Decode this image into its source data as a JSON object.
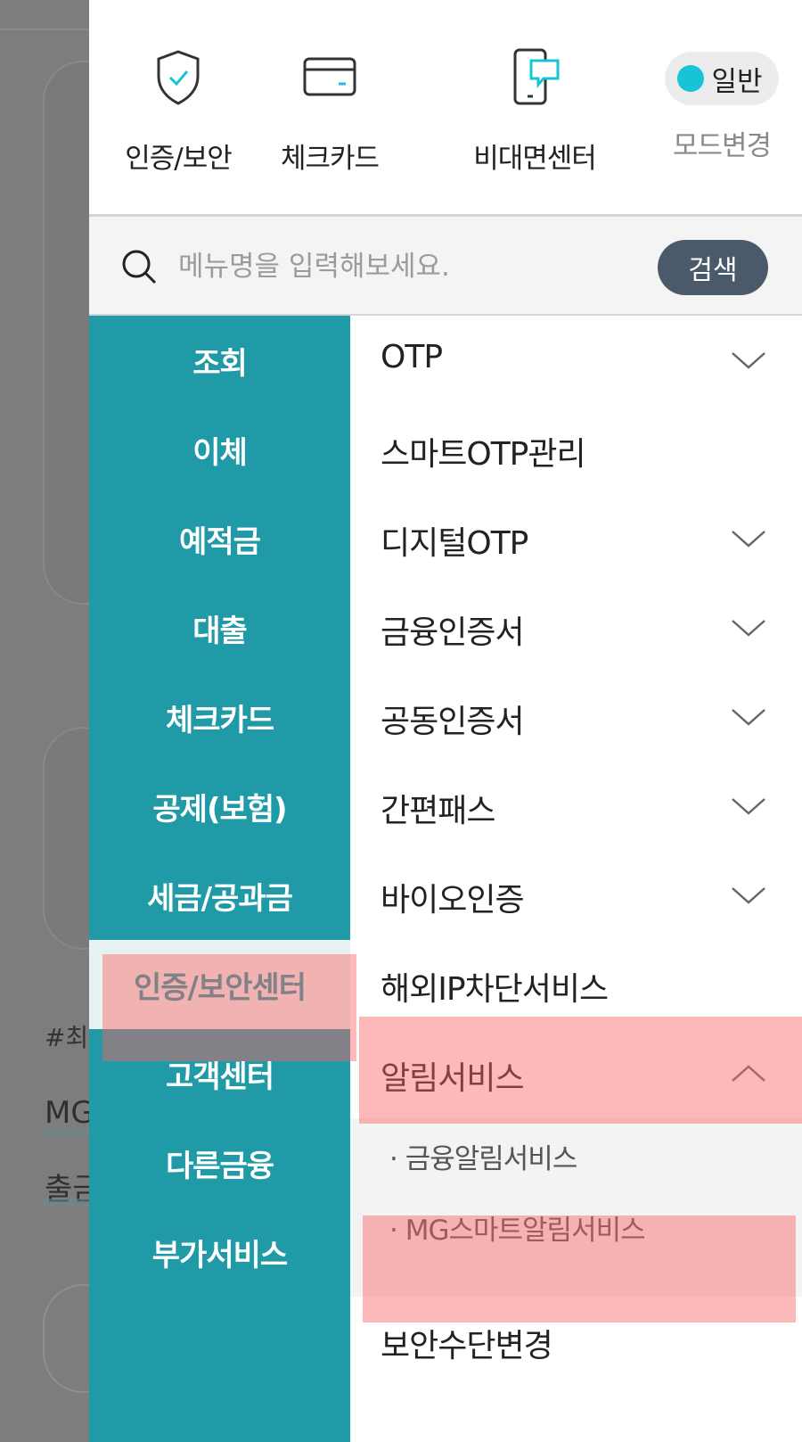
{
  "background": {
    "texts": [
      "#최",
      "MG",
      "출금"
    ]
  },
  "quick_menu": [
    {
      "label": "인증/보안",
      "icon": "shield-check-icon"
    },
    {
      "label": "체크카드",
      "icon": "card-icon"
    },
    {
      "label": "비대면센터",
      "icon": "phone-chat-icon"
    }
  ],
  "mode": {
    "current": "일반",
    "label": "모드변경",
    "dot_color": "#19c3d6"
  },
  "search": {
    "placeholder": "메뉴명을 입력해보세요.",
    "button_label": "검색"
  },
  "categories": [
    {
      "label": "조회",
      "active": false
    },
    {
      "label": "이체",
      "active": false
    },
    {
      "label": "예적금",
      "active": false
    },
    {
      "label": "대출",
      "active": false
    },
    {
      "label": "체크카드",
      "active": false
    },
    {
      "label": "공제(보험)",
      "active": false
    },
    {
      "label": "세금/공과금",
      "active": false
    },
    {
      "label": "인증/보안센터",
      "active": true
    },
    {
      "label": "고객센터",
      "active": false
    },
    {
      "label": "다른금융",
      "active": false
    },
    {
      "label": "부가서비스",
      "active": false
    }
  ],
  "submenu": [
    {
      "label": "OTP",
      "chevron": "down"
    },
    {
      "label": "스마트OTP관리",
      "chevron": "none"
    },
    {
      "label": "디지털OTP",
      "chevron": "down"
    },
    {
      "label": "금융인증서",
      "chevron": "down"
    },
    {
      "label": "공동인증서",
      "chevron": "down"
    },
    {
      "label": "간편패스",
      "chevron": "down"
    },
    {
      "label": "바이오인증",
      "chevron": "down"
    },
    {
      "label": "해외IP차단서비스",
      "chevron": "none"
    },
    {
      "label": "알림서비스",
      "chevron": "up"
    },
    {
      "label": "보안수단변경",
      "chevron": "none"
    }
  ],
  "subsubmenu": [
    {
      "label": "· 금융알림서비스"
    },
    {
      "label": "· MG스마트알림서비스"
    }
  ],
  "colors": {
    "category_bg": "#1f9aa6",
    "search_button_bg": "#4a5a6b",
    "highlight": "#fa6464"
  }
}
